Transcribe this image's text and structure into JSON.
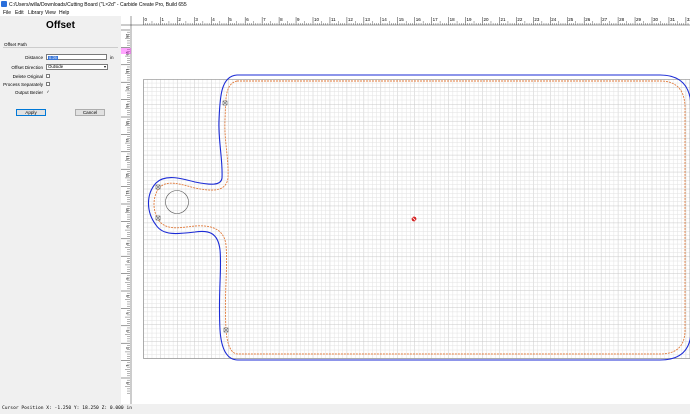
{
  "window": {
    "title": "C:/Users/willa/Downloads/Cutting Board (\"L×2d\" - Carbide Create Pro, Build 655"
  },
  "menu": [
    "File",
    "Edit",
    "Library",
    "View",
    "Help"
  ],
  "panel": {
    "title": "Offset",
    "section": "Offset Path",
    "distance_label": "Distance",
    "distance_value": "0.25",
    "distance_unit": "in",
    "direction_label": "Offset Direction",
    "direction_value": "Outside",
    "delete_original_label": "Delete Original",
    "delete_original_checked": false,
    "process_separately_label": "Process Separately",
    "process_separately_checked": false,
    "output_bezier_label": "Output Bezier",
    "output_bezier_checked": true,
    "apply_label": "Apply",
    "cancel_label": "Cancel"
  },
  "ruler": {
    "top_numbers": [
      "0",
      "1",
      "2",
      "3",
      "4",
      "5",
      "6",
      "7",
      "8",
      "9",
      "10",
      "11",
      "12",
      "13",
      "14",
      "15",
      "16",
      "17",
      "18",
      "19",
      "20",
      "21",
      "22",
      "23",
      "24",
      "25",
      "26",
      "27",
      "28",
      "29",
      "30",
      "31",
      "32"
    ],
    "left_numbers": [
      "20",
      "19",
      "18",
      "17",
      "16",
      "15",
      "14",
      "13",
      "12",
      "11",
      "10",
      "9",
      "8",
      "7",
      "6",
      "5",
      "4",
      "3",
      "2",
      "1",
      "0"
    ]
  },
  "status_bar": {
    "text": "Cursor Position X: -1.250 Y: 18.250 Z: 0.000 in"
  },
  "colors": {
    "original_path": "#e07b3c",
    "offset_path": "#1b2bd6",
    "grid_minor": "#e2e2e2",
    "grid_major": "#c8c8c8",
    "origin_marker": "#d42020"
  }
}
